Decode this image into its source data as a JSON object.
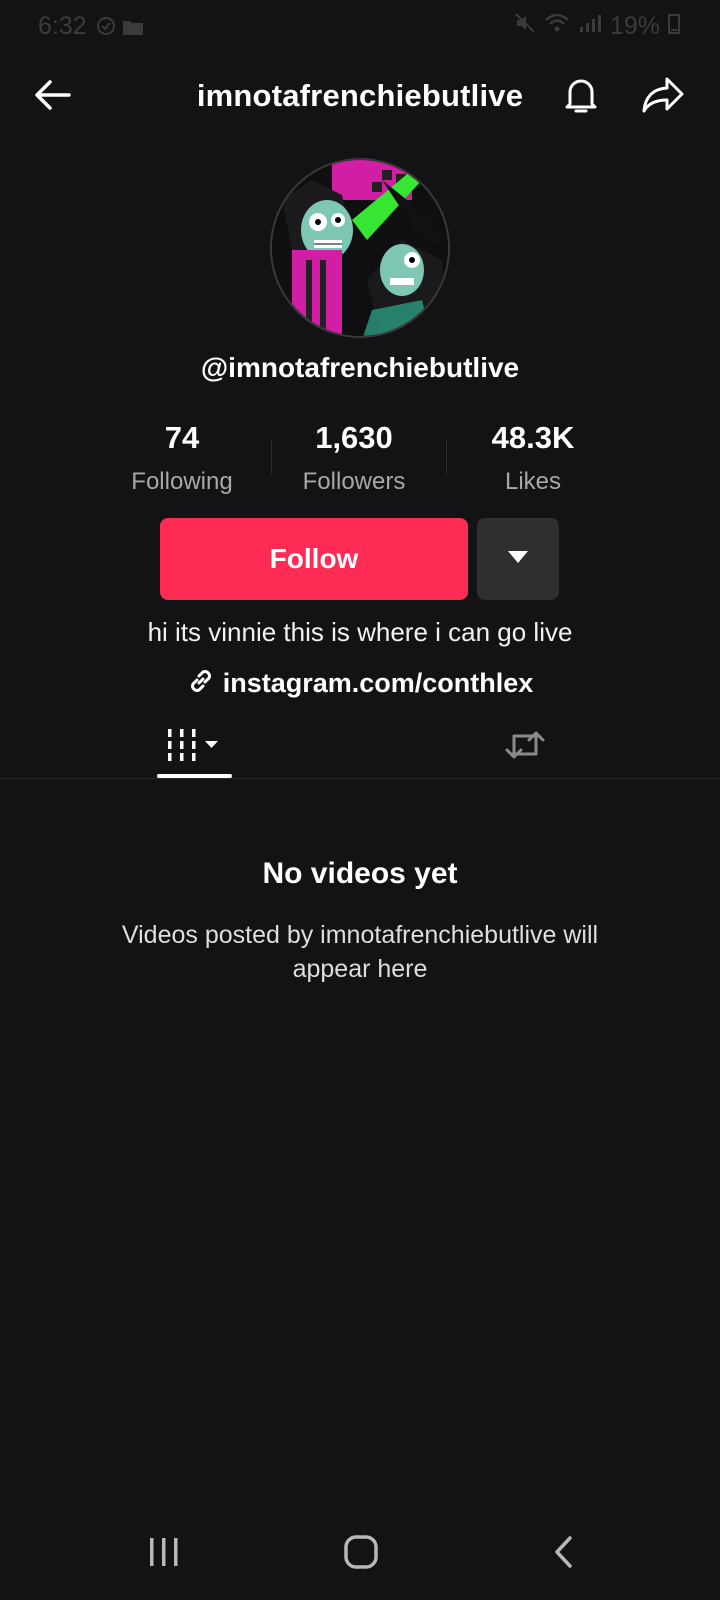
{
  "status_bar": {
    "time": "6:32",
    "battery": "19%"
  },
  "header": {
    "title": "imnotafrenchiebutlive",
    "back_icon": "arrow-left-icon",
    "bell_icon": "bell-icon",
    "share_icon": "share-arrow-icon"
  },
  "profile": {
    "handle": "@imnotafrenchiebutlive",
    "bio": "hi its vinnie this is where i can go live",
    "link": "instagram.com/conthlex"
  },
  "stats": [
    {
      "value": "74",
      "label": "Following"
    },
    {
      "value": "1,630",
      "label": "Followers"
    },
    {
      "value": "48.3K",
      "label": "Likes"
    }
  ],
  "actions": {
    "follow_label": "Follow",
    "follow_color": "#fe2c55"
  },
  "tabs": {
    "videos_icon": "grid-videos-icon",
    "repost_icon": "repost-icon"
  },
  "empty_state": {
    "title": "No videos yet",
    "subtitle": "Videos posted by imnotafrenchiebutlive will appear here"
  }
}
